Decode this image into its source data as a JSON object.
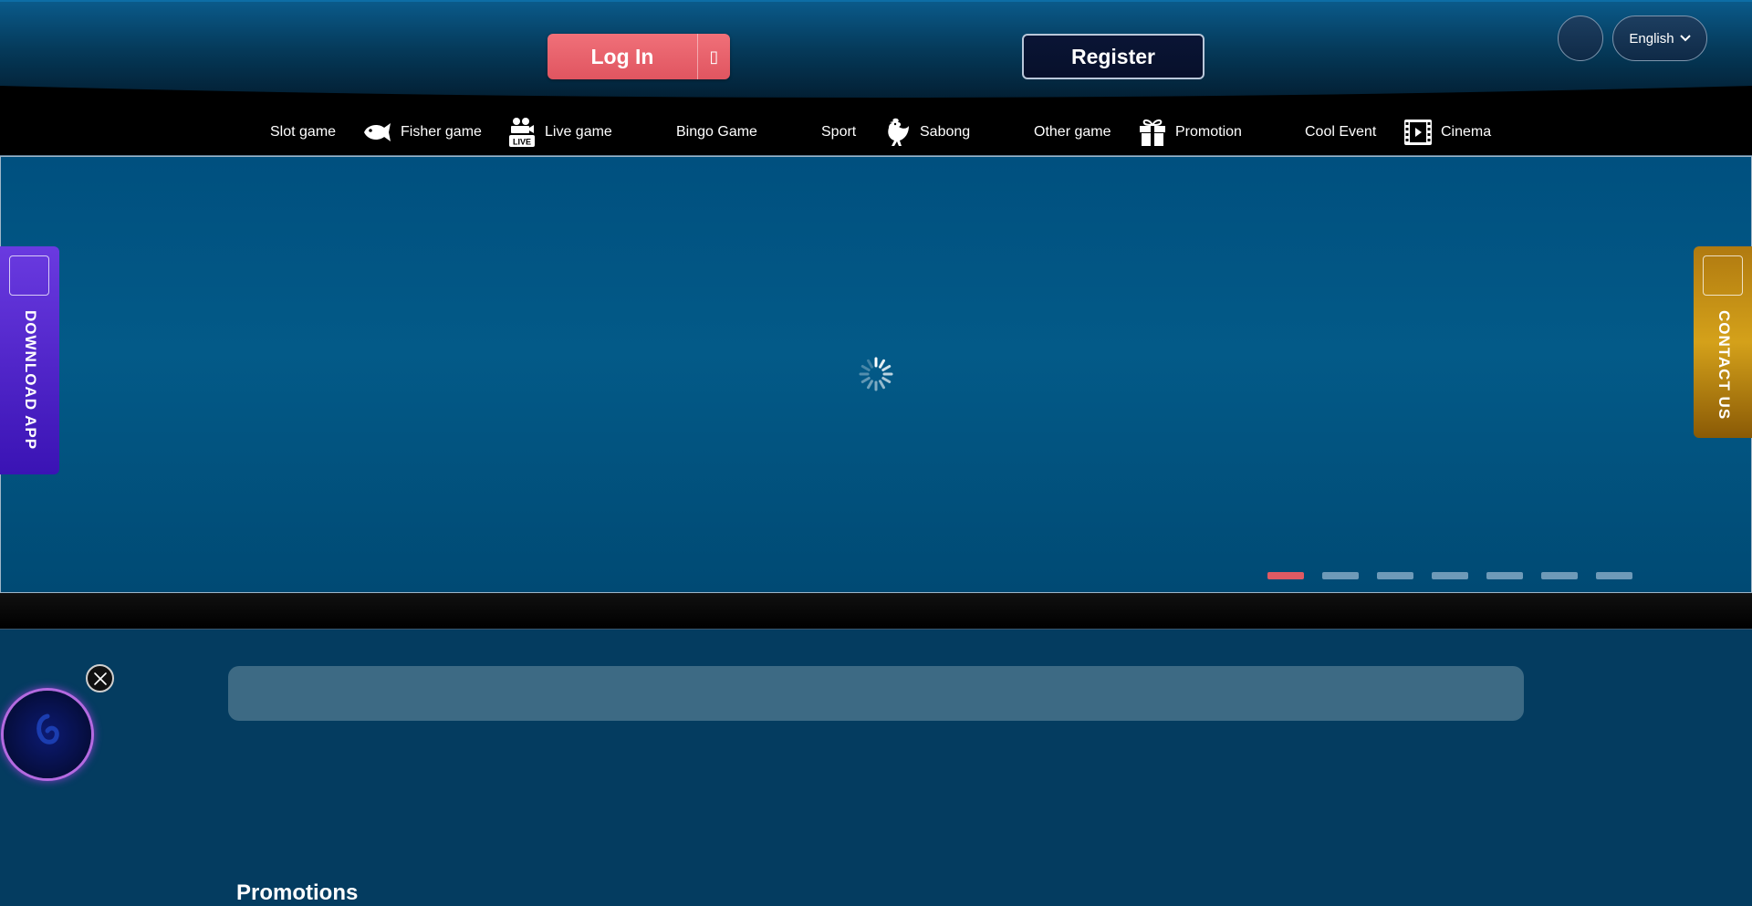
{
  "header": {
    "login_label": "Log In",
    "login_icon_glyph": "▯",
    "register_label": "Register",
    "language": "English"
  },
  "nav": {
    "items": [
      {
        "label": "Slot game",
        "icon": null
      },
      {
        "label": "Fisher game",
        "icon": "fish-icon"
      },
      {
        "label": "Live game",
        "icon": "live-camera-icon"
      },
      {
        "label": "Bingo Game",
        "icon": null
      },
      {
        "label": "Sport",
        "icon": null
      },
      {
        "label": "Sabong",
        "icon": "rooster-icon"
      },
      {
        "label": "Other game",
        "icon": null
      },
      {
        "label": "Promotion",
        "icon": "gift-icon"
      },
      {
        "label": "Cool Event",
        "icon": null
      },
      {
        "label": "Cinema",
        "icon": "film-icon"
      }
    ],
    "live_badge": "LIVE"
  },
  "banner": {
    "slide_count": 7,
    "active_slide": 1
  },
  "side_tabs": {
    "left_label": "DOWNLOAD APP",
    "right_label": "CONTACT US"
  },
  "sections": {
    "promotions_title": "Promotions"
  },
  "colors": {
    "accent_red": "#e05a63",
    "page_blue": "#043c60",
    "download_purple": "#4b22c8",
    "contact_gold": "#c08a12"
  }
}
